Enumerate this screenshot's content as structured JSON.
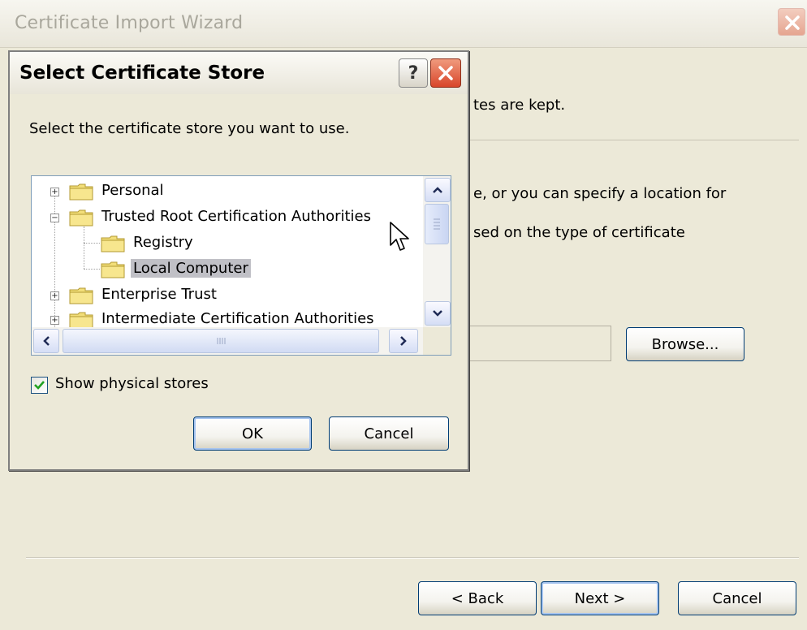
{
  "wizard": {
    "title": "Certificate Import Wizard",
    "text_line1": "tes are kept.",
    "text_line2": "e, or you can specify a location for",
    "text_line3": "sed on the type of certificate",
    "browse_label": "Browse...",
    "back_label": "< Back",
    "next_label": "Next >",
    "cancel_label": "Cancel"
  },
  "dialog": {
    "title": "Select Certificate Store",
    "help_glyph": "?",
    "prompt": "Select the certificate store you want to use.",
    "tree": [
      {
        "label": "Personal",
        "expander": "+",
        "level": 0,
        "selected": false
      },
      {
        "label": "Trusted Root Certification Authorities",
        "expander": "−",
        "level": 0,
        "selected": false
      },
      {
        "label": "Registry",
        "expander": "",
        "level": 1,
        "selected": false
      },
      {
        "label": "Local Computer",
        "expander": "",
        "level": 1,
        "selected": true
      },
      {
        "label": "Enterprise Trust",
        "expander": "+",
        "level": 0,
        "selected": false
      },
      {
        "label": "Intermediate Certification Authorities",
        "expander": "+",
        "level": 0,
        "selected": false
      }
    ],
    "show_physical_label": "Show physical stores",
    "show_physical_checked": true,
    "ok_label": "OK",
    "cancel_label": "Cancel"
  },
  "colors": {
    "window_bg": "#ece9d8",
    "selection_bg": "#c0c0c6",
    "close_red": "#d8452a",
    "button_border": "#003c74",
    "check_green": "#21a121"
  },
  "icons": [
    "help-icon",
    "close-icon",
    "folder-icon",
    "expand-icon",
    "collapse-icon",
    "scroll-up-icon",
    "scroll-down-icon",
    "scroll-left-icon",
    "scroll-right-icon",
    "checkmark-icon",
    "mouse-pointer-icon"
  ]
}
